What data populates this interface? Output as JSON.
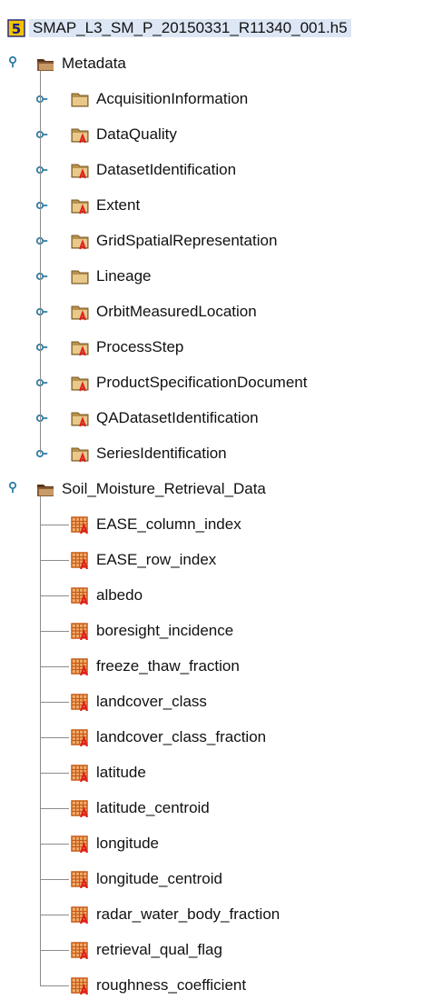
{
  "root": {
    "label": "SMAP_L3_SM_P_20150331_R11340_001.h5",
    "icon": "hdf5-file-icon"
  },
  "groups": [
    {
      "label": "Metadata",
      "expanded": true,
      "icon": "open-folder-icon",
      "children": [
        {
          "label": "AcquisitionInformation",
          "icon": "folder-icon"
        },
        {
          "label": "DataQuality",
          "icon": "folder-attribute-icon"
        },
        {
          "label": "DatasetIdentification",
          "icon": "folder-attribute-icon"
        },
        {
          "label": "Extent",
          "icon": "folder-attribute-icon"
        },
        {
          "label": "GridSpatialRepresentation",
          "icon": "folder-attribute-icon"
        },
        {
          "label": "Lineage",
          "icon": "folder-icon"
        },
        {
          "label": "OrbitMeasuredLocation",
          "icon": "folder-attribute-icon"
        },
        {
          "label": "ProcessStep",
          "icon": "folder-attribute-icon"
        },
        {
          "label": "ProductSpecificationDocument",
          "icon": "folder-attribute-icon"
        },
        {
          "label": "QADatasetIdentification",
          "icon": "folder-attribute-icon"
        },
        {
          "label": "SeriesIdentification",
          "icon": "folder-attribute-icon"
        }
      ]
    },
    {
      "label": "Soil_Moisture_Retrieval_Data",
      "expanded": true,
      "icon": "open-folder-icon",
      "children": [
        {
          "label": "EASE_column_index",
          "icon": "dataset-attribute-icon"
        },
        {
          "label": "EASE_row_index",
          "icon": "dataset-attribute-icon"
        },
        {
          "label": "albedo",
          "icon": "dataset-attribute-icon"
        },
        {
          "label": "boresight_incidence",
          "icon": "dataset-attribute-icon"
        },
        {
          "label": "freeze_thaw_fraction",
          "icon": "dataset-attribute-icon"
        },
        {
          "label": "landcover_class",
          "icon": "dataset-attribute-icon"
        },
        {
          "label": "landcover_class_fraction",
          "icon": "dataset-attribute-icon"
        },
        {
          "label": "latitude",
          "icon": "dataset-attribute-icon"
        },
        {
          "label": "latitude_centroid",
          "icon": "dataset-attribute-icon"
        },
        {
          "label": "longitude",
          "icon": "dataset-attribute-icon"
        },
        {
          "label": "longitude_centroid",
          "icon": "dataset-attribute-icon"
        },
        {
          "label": "radar_water_body_fraction",
          "icon": "dataset-attribute-icon"
        },
        {
          "label": "retrieval_qual_flag",
          "icon": "dataset-attribute-icon"
        },
        {
          "label": "roughness_coefficient",
          "icon": "dataset-attribute-icon"
        }
      ]
    }
  ],
  "colors": {
    "selection": "#dce6f4",
    "folder": "#e8c98a",
    "folder_open_dark": "#5a3418",
    "attr_red": "#e02020",
    "dataset": "#c85a16",
    "connector": "#8c8c8c",
    "toggle": "#2f7fa8"
  }
}
